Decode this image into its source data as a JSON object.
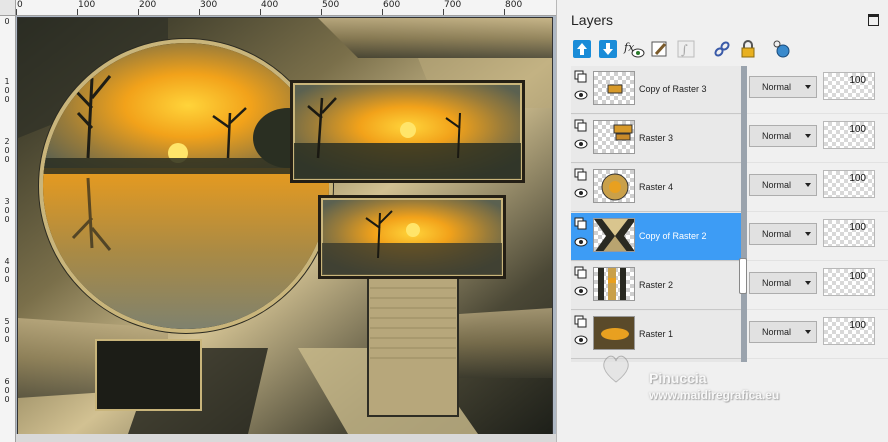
{
  "ruler": {
    "top": [
      "0",
      "100",
      "200",
      "300",
      "400",
      "500",
      "600",
      "700",
      "800"
    ],
    "left": [
      "0",
      "1\n0\n0",
      "2\n0\n0",
      "3\n0\n0",
      "4\n0\n0",
      "5\n0\n0",
      "6\n0\n0"
    ]
  },
  "layers_panel": {
    "title": "Layers",
    "toolbar": [
      "arrow-up-icon",
      "arrow-down-icon",
      "fx-eye-icon",
      "brush-icon",
      "fx-icon",
      "link-icon",
      "lock-icon",
      "mask-icon"
    ],
    "layers": [
      {
        "name": "Copy of Raster 3",
        "blend": "Normal",
        "opacity": "100",
        "selected": false
      },
      {
        "name": "Raster 3",
        "blend": "Normal",
        "opacity": "100",
        "selected": false
      },
      {
        "name": "Raster 4",
        "blend": "Normal",
        "opacity": "100",
        "selected": false
      },
      {
        "name": "Copy of Raster 2",
        "blend": "Normal",
        "opacity": "100",
        "selected": true
      },
      {
        "name": "Raster 2",
        "blend": "Normal",
        "opacity": "100",
        "selected": false
      },
      {
        "name": "Raster 1",
        "blend": "Normal",
        "opacity": "100",
        "selected": false
      }
    ]
  },
  "watermark": {
    "name": "Pinuccia",
    "site": "www.maidiregrafica.eu"
  }
}
